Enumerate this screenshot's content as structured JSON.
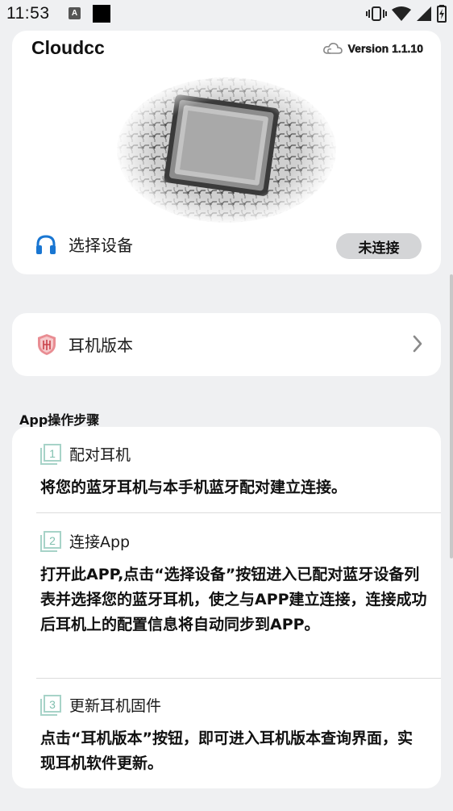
{
  "status_bar": {
    "time": "11:53",
    "a_badge": "A"
  },
  "header": {
    "brand": "Cloudcc",
    "version": "Version 1.1.10"
  },
  "device": {
    "select_label": "选择设备",
    "connection_status": "未连接"
  },
  "firmware": {
    "label": "耳机版本"
  },
  "guide": {
    "title": "App操作步骤",
    "steps": [
      {
        "number": "1",
        "title": "配对耳机",
        "body": "将您的蓝牙耳机与本手机蓝牙配对建立连接。"
      },
      {
        "number": "2",
        "title": "连接App",
        "body": "打开此APP,点击“选择设备”按钮进入已配对蓝牙设备列表并选择您的蓝牙耳机，使之与APP建立连接，连接成功后耳机上的配置信息将自动同步到APP。"
      },
      {
        "number": "3",
        "title": "更新耳机固件",
        "body": "点击“耳机版本”按钮，即可进入耳机版本查询界面，实现耳机软件更新。"
      }
    ]
  },
  "colors": {
    "accent_blue": "#1976d2",
    "badge_red": "#c9414a",
    "step_icon": "#a7d3c8"
  }
}
